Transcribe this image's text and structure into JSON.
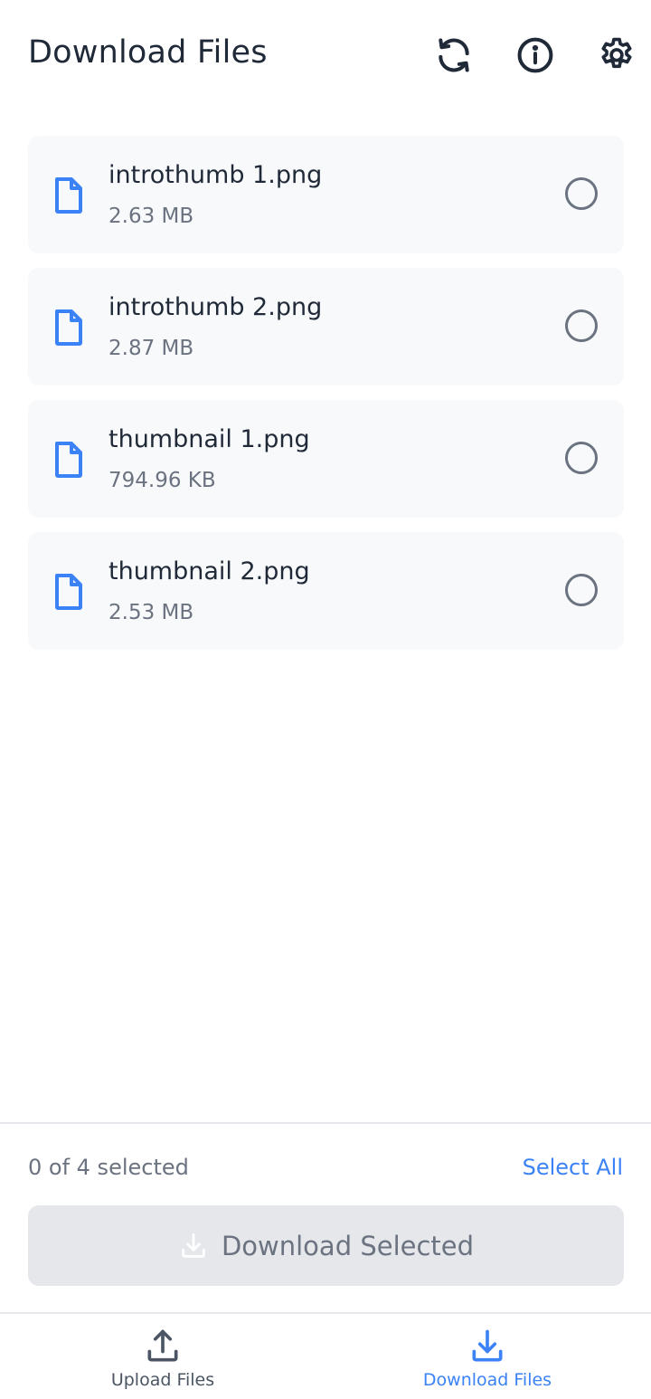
{
  "header": {
    "title": "Download Files",
    "icons": [
      "refresh-icon",
      "info-icon",
      "gear-icon"
    ]
  },
  "files": [
    {
      "name": "introthumb 1.png",
      "size": "2.63 MB",
      "selected": false
    },
    {
      "name": "introthumb 2.png",
      "size": "2.87 MB",
      "selected": false
    },
    {
      "name": "thumbnail 1.png",
      "size": "794.96 KB",
      "selected": false
    },
    {
      "name": "thumbnail 2.png",
      "size": "2.53 MB",
      "selected": false
    }
  ],
  "footer": {
    "selection_count": "0 of 4 selected",
    "select_all_label": "Select All",
    "download_button_label": "Download Selected",
    "download_button_disabled": true
  },
  "tabs": [
    {
      "label": "Upload Files",
      "icon": "upload-icon",
      "active": false
    },
    {
      "label": "Download Files",
      "icon": "download-icon",
      "active": true
    }
  ],
  "colors": {
    "accent": "#3b82f6",
    "text_primary": "#1f2937",
    "text_secondary": "#6b7280",
    "card_bg": "#f8f9fb",
    "button_disabled_bg": "#e5e7eb"
  }
}
